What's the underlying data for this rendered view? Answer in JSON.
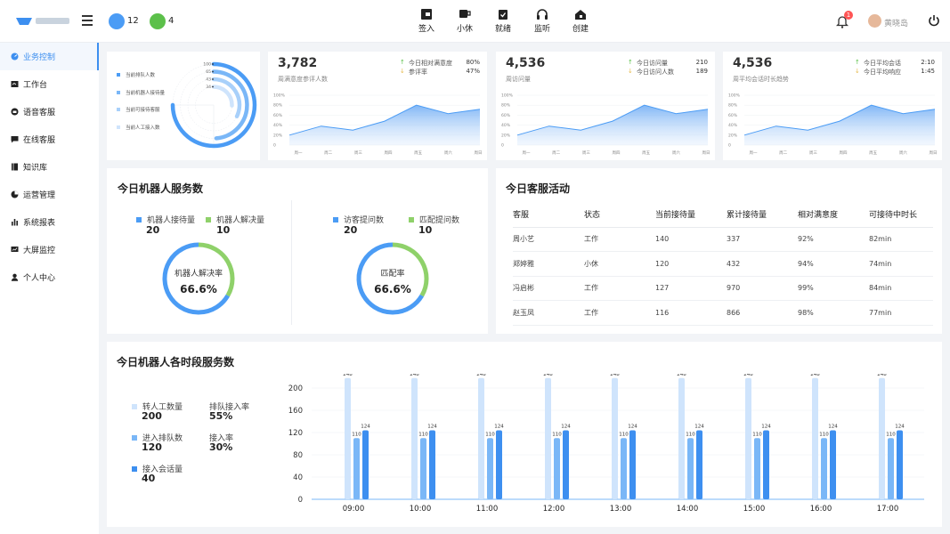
{
  "header": {
    "status": [
      {
        "color": "#4b9cf5",
        "count": "12"
      },
      {
        "color": "#5cc04a",
        "count": "4"
      }
    ],
    "nav": [
      {
        "icon": "check-in-icon",
        "label": "签入"
      },
      {
        "icon": "coffee-icon",
        "label": "小休"
      },
      {
        "icon": "clipboard-icon",
        "label": "就绪"
      },
      {
        "icon": "headset-icon",
        "label": "监听"
      },
      {
        "icon": "create-icon",
        "label": "创建"
      }
    ],
    "notification_count": "1",
    "username": "黄晓岛"
  },
  "sidebar": {
    "items": [
      {
        "icon": "dashboard-icon",
        "label": "业务控制",
        "active": true
      },
      {
        "icon": "workbench-icon",
        "label": "工作台"
      },
      {
        "icon": "voice-service-icon",
        "label": "语音客服"
      },
      {
        "icon": "chat-icon",
        "label": "在线客服"
      },
      {
        "icon": "book-icon",
        "label": "知识库"
      },
      {
        "icon": "pie-icon",
        "label": "运营管理"
      },
      {
        "icon": "report-icon",
        "label": "系统报表"
      },
      {
        "icon": "monitor-icon",
        "label": "大屏监控"
      },
      {
        "icon": "user-icon",
        "label": "个人中心"
      }
    ]
  },
  "radial": {
    "legend": [
      "当前排队人数",
      "当前机器人接待量",
      "当前可接待客服",
      "当前人工接入数"
    ],
    "ticks": [
      "100",
      "65",
      "43",
      "34"
    ],
    "values": [
      100,
      65,
      43,
      34
    ],
    "colors": [
      "#4b9cf5",
      "#7ab7f7",
      "#a8d0fa",
      "#cfe4fc"
    ]
  },
  "kpis": [
    {
      "value": "3,782",
      "sub": "周满意度参评人数",
      "rows": [
        {
          "arrow": "up",
          "k": "今日相对满意度",
          "v": "80%"
        },
        {
          "arrow": "down",
          "k": "参评率",
          "v": "47%"
        }
      ]
    },
    {
      "value": "4,536",
      "sub": "周访问量",
      "rows": [
        {
          "arrow": "up",
          "k": "今日访问量",
          "v": "210"
        },
        {
          "arrow": "down",
          "k": "今日访问人数",
          "v": "189"
        }
      ]
    },
    {
      "value": "4,536",
      "sub": "周平均会话时长趋势",
      "rows": [
        {
          "arrow": "up",
          "k": "今日平均会话",
          "v": "2:10"
        },
        {
          "arrow": "down",
          "k": "今日平均响应",
          "v": "1:45"
        }
      ]
    }
  ],
  "area_charts": {
    "y_ticks": [
      "100%",
      "80%",
      "60%",
      "40%",
      "20%",
      "0"
    ],
    "days": [
      "周一",
      "周二",
      "周三",
      "周四",
      "周五",
      "周六",
      "周日"
    ],
    "values": [
      20,
      38,
      30,
      48,
      80,
      63,
      72
    ]
  },
  "robot_service": {
    "title": "今日机器人服务数",
    "left": {
      "legend": [
        {
          "label": "机器人接待量",
          "value": "20",
          "color": "#4b9cf5"
        },
        {
          "label": "机器人解决量",
          "value": "10",
          "color": "#8fd16a"
        }
      ],
      "center_label": "机器人解决率",
      "percent": "66.6%",
      "ratio": 0.666
    },
    "right": {
      "legend": [
        {
          "label": "访客提问数",
          "value": "20",
          "color": "#4b9cf5"
        },
        {
          "label": "匹配提问数",
          "value": "10",
          "color": "#8fd16a"
        }
      ],
      "center_label": "匹配率",
      "percent": "66.6%",
      "ratio": 0.666
    }
  },
  "activity": {
    "title": "今日客服活动",
    "columns": [
      "客服",
      "状态",
      "当前接待量",
      "累计接待量",
      "相对满意度",
      "可接待中时长"
    ],
    "rows": [
      [
        "周小艺",
        "工作",
        "140",
        "337",
        "92%",
        "82min"
      ],
      [
        "郑婷雅",
        "小休",
        "120",
        "432",
        "94%",
        "74min"
      ],
      [
        "冯启彬",
        "工作",
        "127",
        "970",
        "99%",
        "84min"
      ],
      [
        "赵玉凤",
        "工作",
        "116",
        "866",
        "98%",
        "77min"
      ]
    ]
  },
  "hourly": {
    "title": "今日机器人各时段服务数",
    "stats": [
      {
        "label": "转人工数量",
        "value": "200",
        "color": "#cfe4fc"
      },
      {
        "label": "排队接入率",
        "value": "55%"
      },
      {
        "label": "进入排队数",
        "value": "120",
        "color": "#7ab7f7"
      },
      {
        "label": "接入率",
        "value": "30%"
      },
      {
        "label": "接入会话量",
        "value": "40",
        "color": "#3d8ff0"
      }
    ]
  },
  "chart_data": {
    "type": "bar",
    "categories": [
      "09:00",
      "10:00",
      "11:00",
      "12:00",
      "13:00",
      "14:00",
      "15:00",
      "16:00",
      "17:00"
    ],
    "series": [
      {
        "name": "转人工数量",
        "color": "#cfe4fc",
        "values": [
          248,
          248,
          248,
          248,
          248,
          248,
          248,
          248,
          248
        ]
      },
      {
        "name": "进入排队数",
        "color": "#7ab7f7",
        "values": [
          110,
          110,
          110,
          110,
          110,
          110,
          110,
          110,
          110
        ]
      },
      {
        "name": "接入会话量",
        "color": "#3d8ff0",
        "values": [
          124,
          124,
          124,
          124,
          124,
          124,
          124,
          124,
          124
        ]
      }
    ],
    "y_ticks": [
      "200",
      "160",
      "120",
      "80",
      "40",
      "0"
    ],
    "ylim": [
      0,
      200
    ]
  }
}
